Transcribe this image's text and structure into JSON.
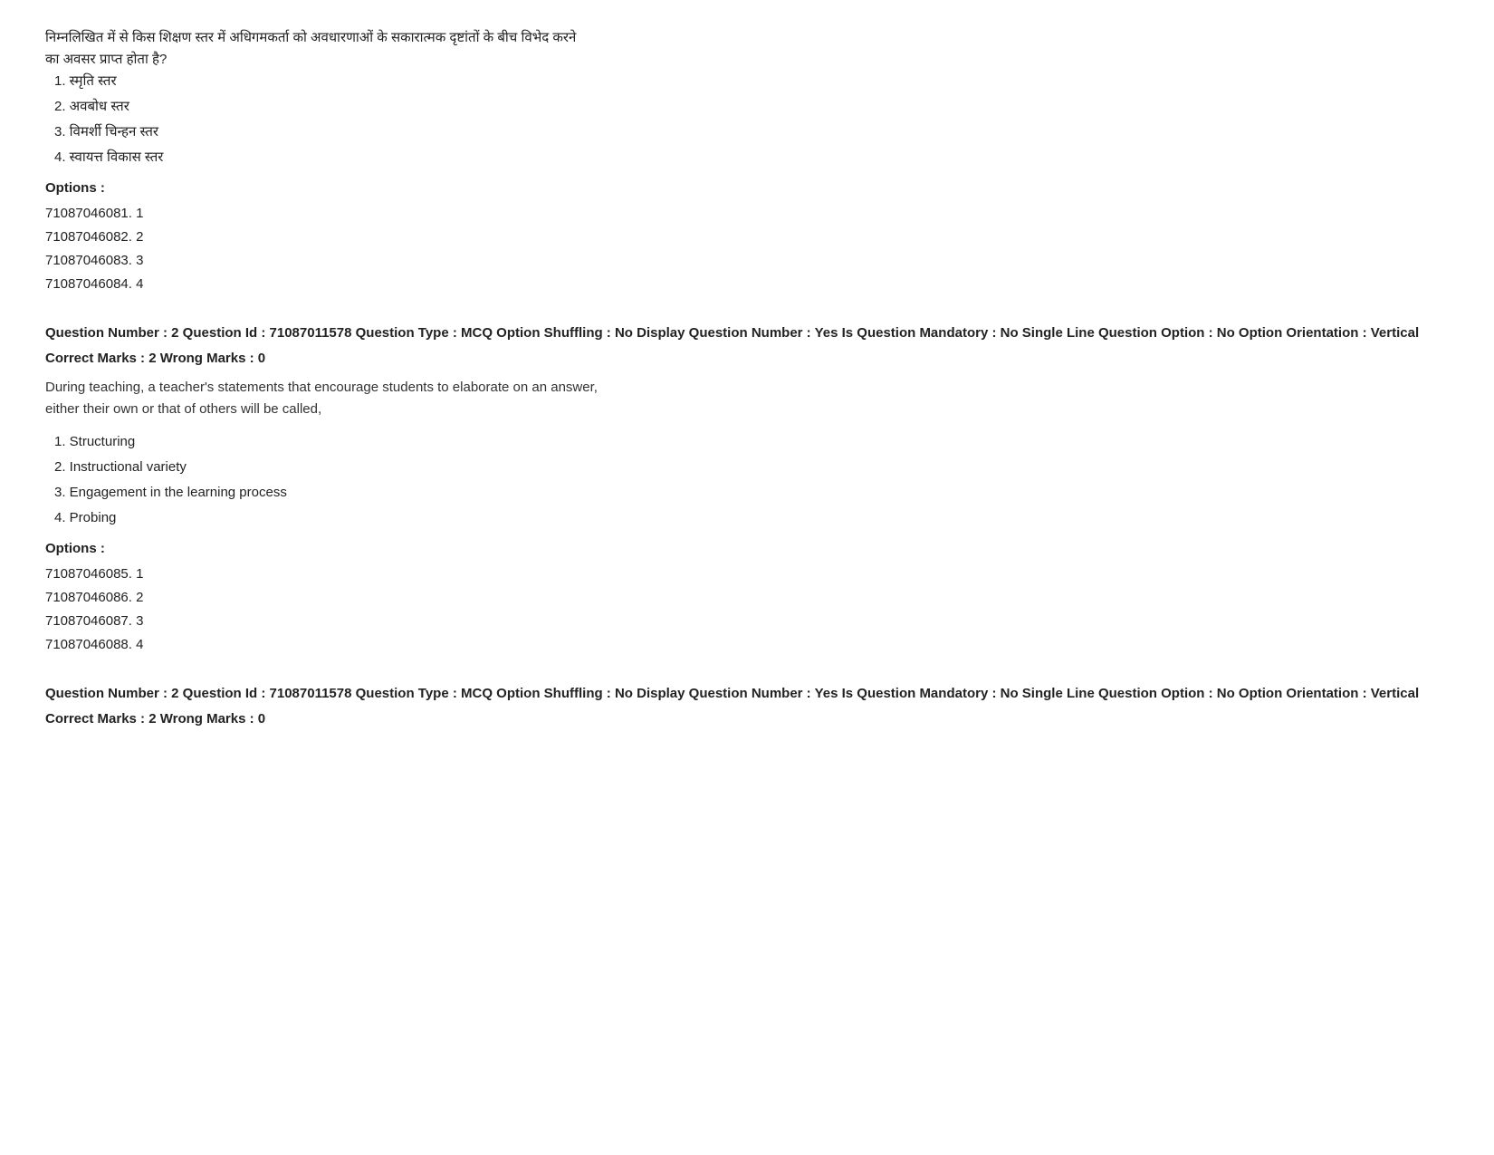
{
  "page": {
    "question1": {
      "hindi_text_line1": "निम्नलिखित में से किस शिक्षण स्तर में अधिगमकर्ता को अवधारणाओं के सकारात्मक दृष्टांतों के बीच विभेद करने",
      "hindi_text_line2": "का अवसर प्राप्त होता है?",
      "choices": [
        "1. स्मृति स्तर",
        "2. अवबोध स्तर",
        "3. विमर्शी चिन्हन स्तर",
        "4. स्वायत्त विकास स्तर"
      ],
      "options_label": "Options :",
      "answer_options": [
        "71087046081. 1",
        "71087046082. 2",
        "71087046083. 3",
        "71087046084. 4"
      ]
    },
    "question2": {
      "meta": "Question Number : 2  Question Id : 71087011578  Question Type : MCQ  Option Shuffling : No  Display Question Number : Yes  Is Question Mandatory : No  Single Line Question Option : No  Option Orientation : Vertical",
      "marks": "Correct Marks : 2  Wrong Marks : 0",
      "text_line1": "During teaching, a teacher's statements that encourage students to elaborate on an answer,",
      "text_line2": "either their own or that of others will be called,",
      "choices": [
        "1. Structuring",
        "2. Instructional variety",
        "3. Engagement in the learning process",
        "4. Probing"
      ],
      "options_label": "Options :",
      "answer_options": [
        "71087046085. 1",
        "71087046086. 2",
        "71087046087. 3",
        "71087046088. 4"
      ]
    },
    "question3": {
      "meta": "Question Number : 2  Question Id : 71087011578  Question Type : MCQ  Option Shuffling : No  Display Question Number : Yes  Is Question Mandatory : No  Single Line Question Option : No  Option Orientation : Vertical",
      "marks": "Correct Marks : 2  Wrong Marks : 0"
    }
  }
}
